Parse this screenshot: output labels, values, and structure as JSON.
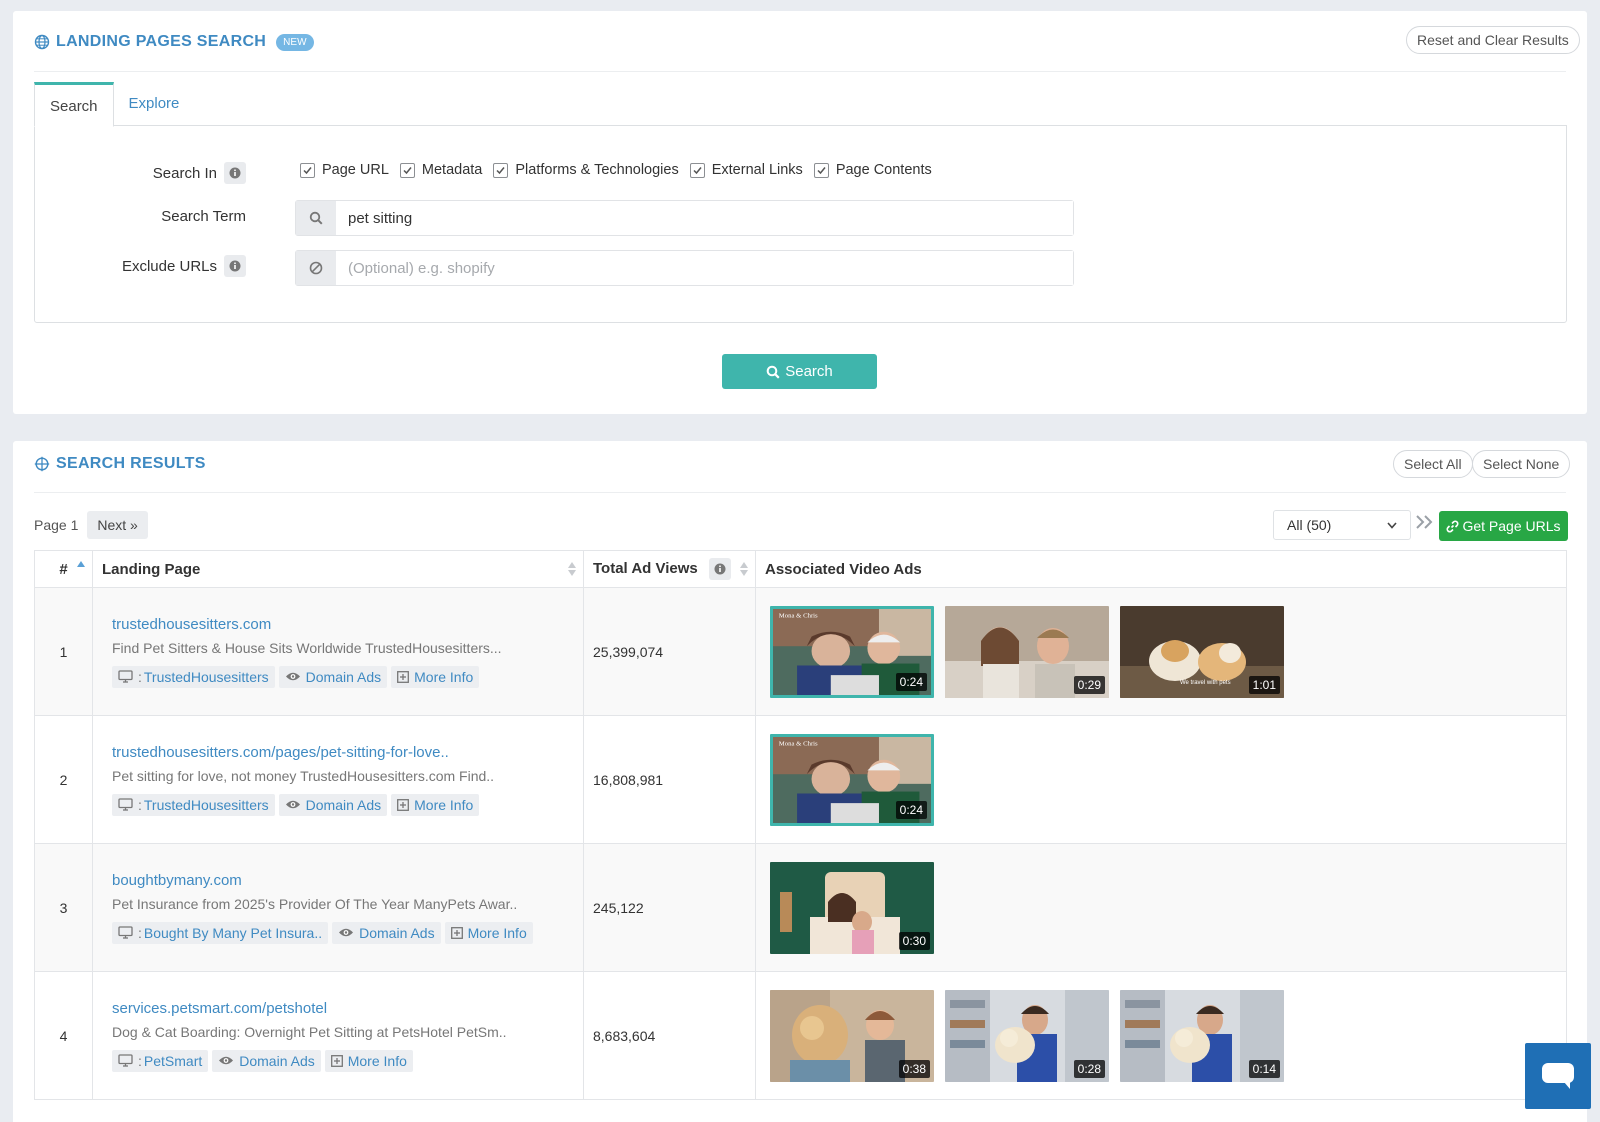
{
  "search_panel": {
    "title": "LANDING PAGES SEARCH",
    "badge": "NEW",
    "reset_label": "Reset and Clear Results",
    "tabs": [
      {
        "label": "Search"
      },
      {
        "label": "Explore"
      }
    ],
    "search_in_label": "Search In",
    "search_in_options": [
      {
        "label": "Page URL",
        "checked": true
      },
      {
        "label": "Metadata",
        "checked": true
      },
      {
        "label": "Platforms & Technologies",
        "checked": true
      },
      {
        "label": "External Links",
        "checked": true
      },
      {
        "label": "Page Contents",
        "checked": true
      }
    ],
    "search_term_label": "Search Term",
    "search_term_value": "pet sitting",
    "exclude_label": "Exclude URLs",
    "exclude_placeholder": "(Optional) e.g. shopify",
    "search_button": "Search"
  },
  "results_panel": {
    "title": "SEARCH RESULTS",
    "select_all": "Select All",
    "select_none": "Select None",
    "page_label": "Page 1",
    "next_label": "Next »",
    "filter_value": "All (50)",
    "get_urls_label": "Get Page URLs",
    "columns": {
      "num": "#",
      "landing_page": "Landing Page",
      "views": "Total Ad Views",
      "ads": "Associated Video Ads"
    },
    "rows": [
      {
        "num": "1",
        "url": "trustedhousesitters.com",
        "desc": "Find Pet Sitters & House Sits Worldwide TrustedHousesitters...",
        "advertiser": "TrustedHousesitters",
        "domain_ads": "Domain Ads",
        "more_info": "More Info",
        "views": "25,399,074",
        "videos": [
          {
            "duration": "0:24",
            "scene": "couple-laptop",
            "selected": true
          },
          {
            "duration": "0:29",
            "scene": "couple-sofa",
            "selected": false
          },
          {
            "duration": "1:01",
            "scene": "guinea-pigs",
            "selected": false
          }
        ]
      },
      {
        "num": "2",
        "url": "trustedhousesitters.com/pages/pet-sitting-for-love..",
        "desc": "Pet sitting for love, not money TrustedHousesitters.com Find..",
        "advertiser": "TrustedHousesitters",
        "domain_ads": "Domain Ads",
        "more_info": "More Info",
        "views": "16,808,981",
        "videos": [
          {
            "duration": "0:24",
            "scene": "couple-laptop",
            "selected": true
          }
        ]
      },
      {
        "num": "3",
        "url": "boughtbymany.com",
        "desc": "Pet Insurance from 2025's Provider Of The Year ManyPets Awar..",
        "advertiser": "Bought By Many Pet Insura..",
        "domain_ads": "Domain Ads",
        "more_info": "More Info",
        "views": "245,122",
        "videos": [
          {
            "duration": "0:30",
            "scene": "green-bedroom",
            "selected": false
          }
        ]
      },
      {
        "num": "4",
        "url": "services.petsmart.com/petshotel",
        "desc": "Dog & Cat Boarding: Overnight Pet Sitting at PetsHotel PetSm..",
        "advertiser": "PetSmart",
        "domain_ads": "Domain Ads",
        "more_info": "More Info",
        "views": "8,683,604",
        "videos": [
          {
            "duration": "0:38",
            "scene": "dog-groomer",
            "selected": false
          },
          {
            "duration": "0:28",
            "scene": "store-dog",
            "selected": false
          },
          {
            "duration": "0:14",
            "scene": "store-dog",
            "selected": false
          }
        ]
      }
    ]
  },
  "colors": {
    "accent": "#3fb5ac",
    "link": "#3f8ac2",
    "green": "#28a745",
    "chat": "#1f6fb5"
  },
  "icons": [
    "globe-icon",
    "info-icon",
    "search-icon",
    "ban-icon",
    "crosshair-icon",
    "monitor-icon",
    "eye-icon",
    "plus-square-icon",
    "link-icon",
    "sort-icon",
    "chat-icon"
  ]
}
